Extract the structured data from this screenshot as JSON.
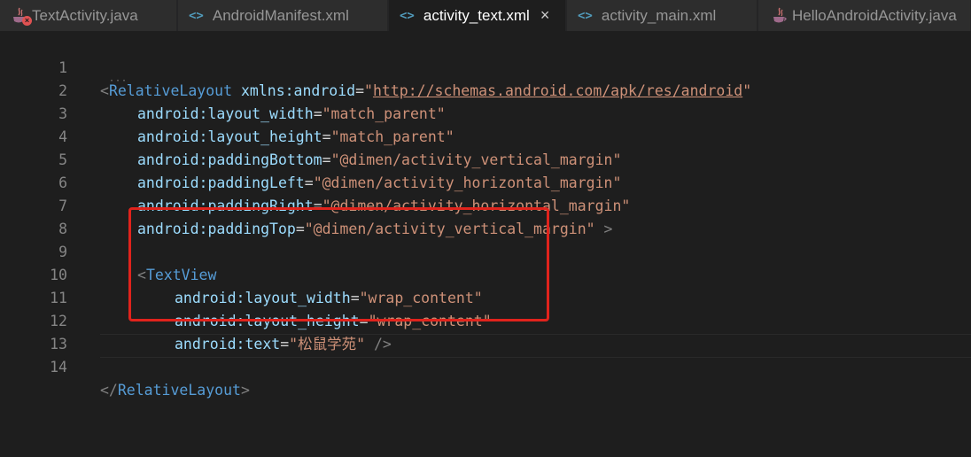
{
  "tabs": [
    {
      "label": "TextActivity.java",
      "type": "java",
      "active": false,
      "error": true
    },
    {
      "label": "AndroidManifest.xml",
      "type": "xml",
      "active": false
    },
    {
      "label": "activity_text.xml",
      "type": "xml",
      "active": true,
      "close": "×"
    },
    {
      "label": "activity_main.xml",
      "type": "xml",
      "active": false
    },
    {
      "label": "HelloAndroidActivity.java",
      "type": "java",
      "active": false
    }
  ],
  "icons": {
    "xml": "<>",
    "error": "×",
    "colors": {
      "xml": "#519aba",
      "error": "#e05252",
      "highlight": "#e0231c"
    }
  },
  "editor": {
    "line_numbers": [
      "1",
      "2",
      "3",
      "4",
      "5",
      "6",
      "7",
      "8",
      "9",
      "10",
      "11",
      "12",
      "13",
      "14"
    ],
    "l1": {
      "open": "<",
      "tag": "RelativeLayout",
      "attr": "xmlns:android",
      "eq": "=",
      "q1": "\"",
      "url": "http://schemas.android.com/apk/res/android",
      "q2": "\""
    },
    "l2": {
      "attr": "android:layout_width",
      "eq": "=",
      "val": "\"match_parent\""
    },
    "l3": {
      "attr": "android:layout_height",
      "eq": "=",
      "val": "\"match_parent\""
    },
    "l4": {
      "attr": "android:paddingBottom",
      "eq": "=",
      "val": "\"@dimen/activity_vertical_margin\""
    },
    "l5": {
      "attr": "android:paddingLeft",
      "eq": "=",
      "val": "\"@dimen/activity_horizontal_margin\""
    },
    "l6": {
      "attr": "android:paddingRight",
      "eq": "=",
      "val": "\"@dimen/activity_horizontal_margin\""
    },
    "l7": {
      "attr": "android:paddingTop",
      "eq": "=",
      "val": "\"@dimen/activity_vertical_margin\"",
      "close": " >"
    },
    "l9": {
      "open": "<",
      "tag": "TextView"
    },
    "l10": {
      "attr": "android:layout_width",
      "eq": "=",
      "val": "\"wrap_content\""
    },
    "l11": {
      "attr": "android:layout_height",
      "eq": "=",
      "val": "\"wrap_content\""
    },
    "l12": {
      "attr": "android:text",
      "eq": "=",
      "val": "\"松鼠学苑\"",
      "close": " />"
    },
    "l14": {
      "open": "</",
      "tag": "RelativeLayout",
      "close": ">"
    }
  }
}
